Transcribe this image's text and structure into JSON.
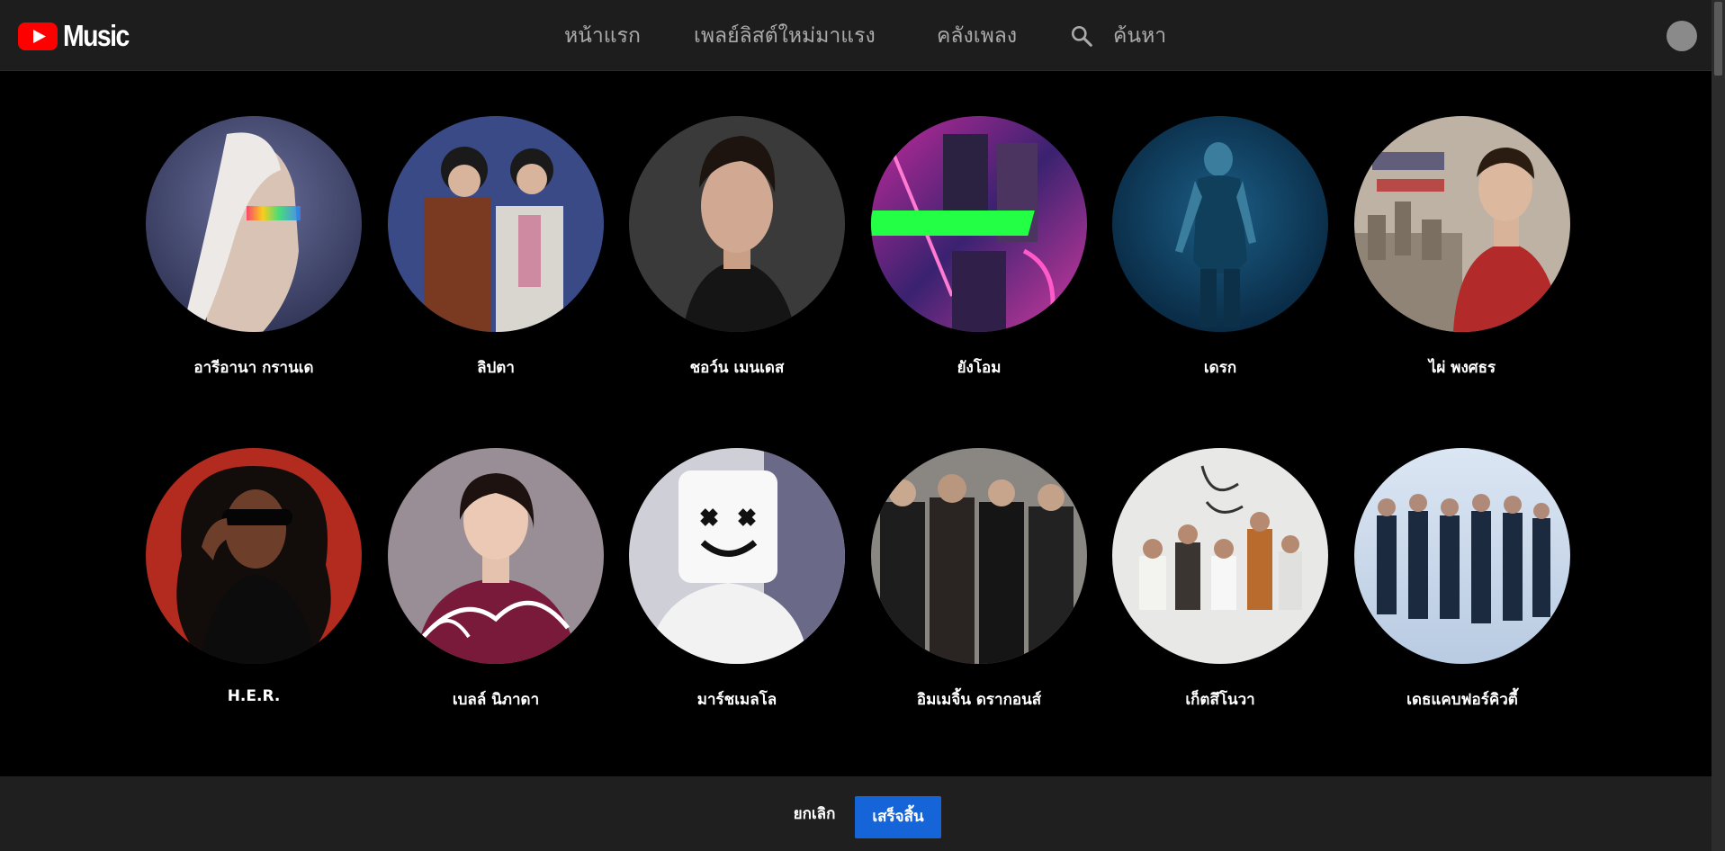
{
  "app": {
    "logo_text": "Music",
    "logo_icon": "youtube-play-icon"
  },
  "nav": {
    "home": "หน้าแรก",
    "hotlist": "เพลย์ลิสต์ใหม่มาแรง",
    "library": "คลังเพลง",
    "search": "ค้นหา",
    "search_icon": "search-icon"
  },
  "artists": [
    {
      "name": "อารีอานา กรานเด"
    },
    {
      "name": "ลิปตา"
    },
    {
      "name": "ชอว์น เมนเดส"
    },
    {
      "name": "ยังโอม"
    },
    {
      "name": "เดรก"
    },
    {
      "name": "ไผ่ พงศธร"
    },
    {
      "name": "H.E.R."
    },
    {
      "name": "เบลล์ นิภาดา"
    },
    {
      "name": "มาร์ชเมลโล"
    },
    {
      "name": "อิมเมจิ้น ดรากอนส์"
    },
    {
      "name": "เก็ตสึโนวา"
    },
    {
      "name": "เดธแคบฟอร์คิวตี้"
    }
  ],
  "footer": {
    "cancel_label": "ยกเลิก",
    "done_label": "เสร็จสิ้น"
  },
  "colors": {
    "brand_red": "#ff0000",
    "accent_blue": "#1565d8",
    "topbar_bg": "#1d1d1d",
    "page_bg": "#000000"
  }
}
